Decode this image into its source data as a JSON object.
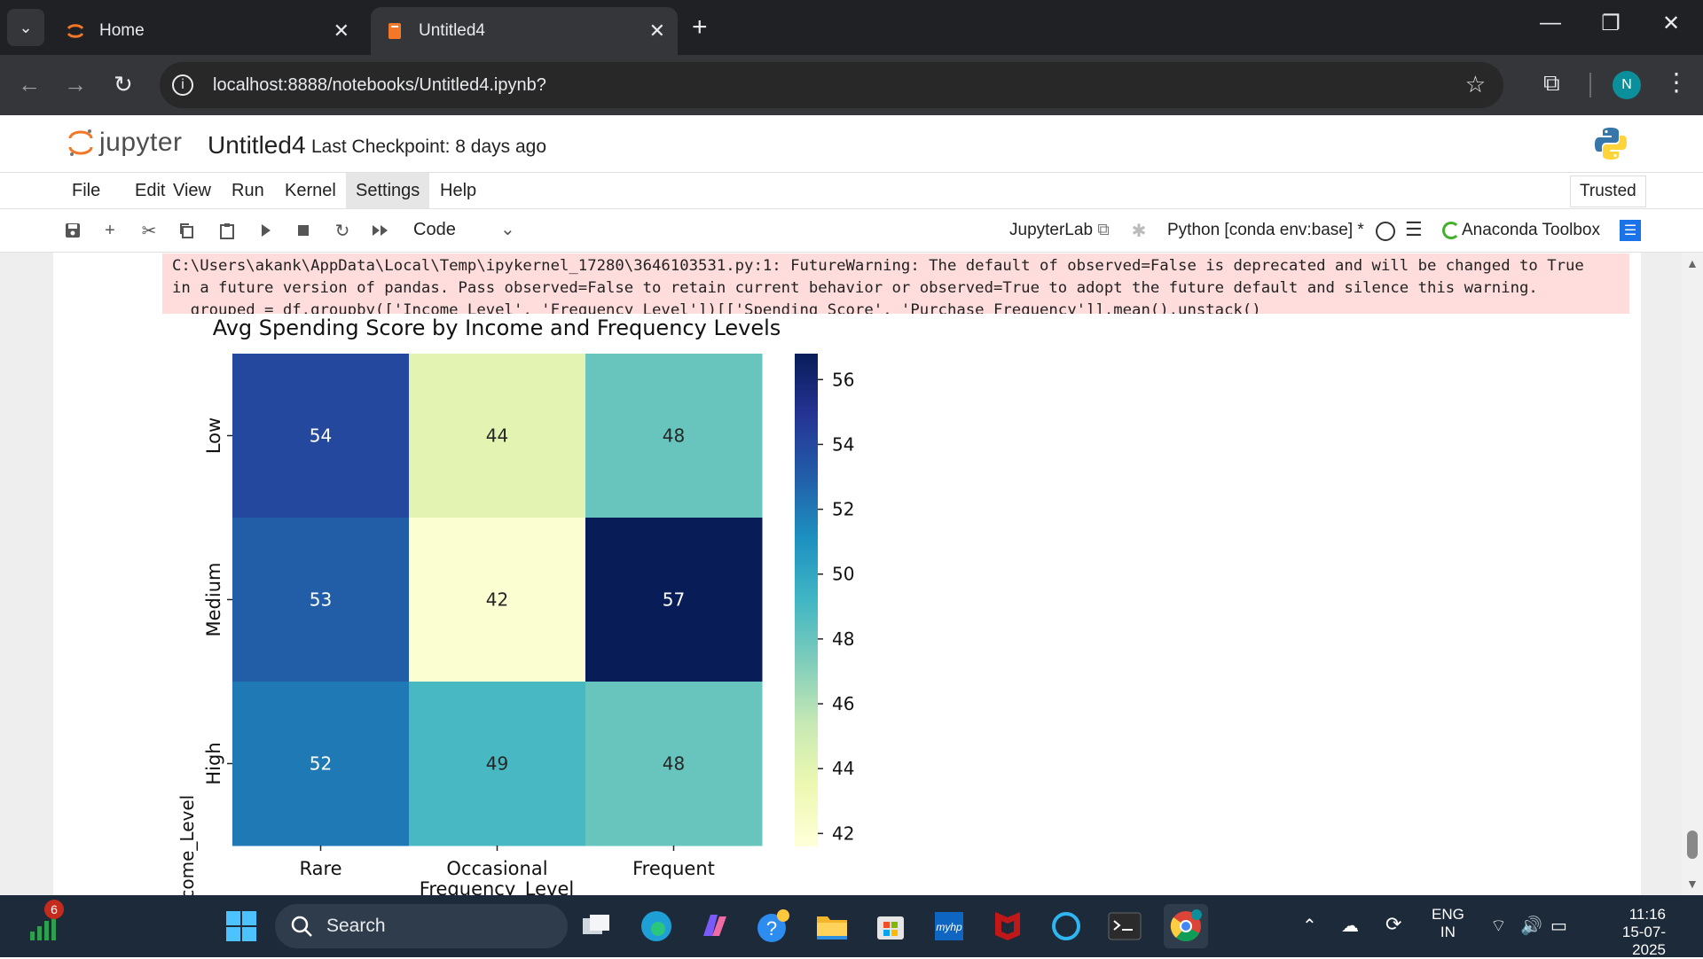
{
  "browser": {
    "tabs": [
      {
        "label": "Home",
        "active": false
      },
      {
        "label": "Untitled4",
        "active": true
      }
    ],
    "url": "localhost:8888/notebooks/Untitled4.ipynb?",
    "profile_initial": "N"
  },
  "jupyter": {
    "logo_text": "jupyter",
    "notebook_title": "Untitled4",
    "checkpoint": "Last Checkpoint: 8 days ago",
    "menu": [
      "File",
      "Edit",
      "View",
      "Run",
      "Kernel",
      "Settings",
      "Help"
    ],
    "trusted": "Trusted",
    "cell_type": "Code",
    "jupyterlab_link": "JupyterLab",
    "kernel": "Python [conda env:base] *",
    "anaconda": "Anaconda Toolbox"
  },
  "warning_lines": [
    "C:\\Users\\akank\\AppData\\Local\\Temp\\ipykernel_17280\\3646103531.py:1: FutureWarning: The default of observed=False is deprecated and will be changed to True",
    "in a future version of pandas. Pass observed=False to retain current behavior or observed=True to adopt the future default and silence this warning.",
    "  grouped = df.groupby(['Income_Level', 'Frequency_Level'])[['Spending_Score', 'Purchase_Frequency']].mean().unstack()"
  ],
  "chart_data": {
    "type": "heatmap",
    "title": "Avg Spending Score by Income and Frequency Levels",
    "xlabel": "Frequency_Level",
    "ylabel": "Income_Level",
    "x_categories": [
      "Rare",
      "Occasional",
      "Frequent"
    ],
    "y_categories": [
      "Low",
      "Medium",
      "High"
    ],
    "values": [
      [
        54,
        44,
        48
      ],
      [
        53,
        42,
        57
      ],
      [
        52,
        49,
        48
      ]
    ],
    "colorbar": {
      "min": 41.6,
      "max": 56.8,
      "ticks": [
        42,
        44,
        46,
        48,
        50,
        52,
        54,
        56
      ],
      "colormap": "YlGnBu"
    }
  },
  "taskbar": {
    "search_label": "Search",
    "badge": "6",
    "lang1": "ENG",
    "lang2": "IN",
    "time": "11:16",
    "date": "15-07-2025"
  }
}
